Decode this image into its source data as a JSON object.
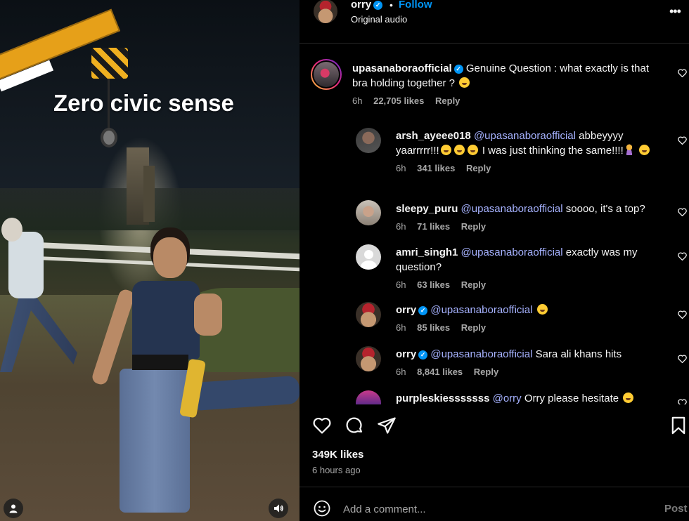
{
  "video": {
    "overlay_text": "Zero civic sense",
    "user_icon": "user-icon",
    "sound_icon": "speaker-icon"
  },
  "header": {
    "username": "orry",
    "verified": true,
    "dot": "•",
    "follow_label": "Follow",
    "subtitle": "Original audio",
    "more_icon": "more-icon"
  },
  "comments": [
    {
      "username": "upasanaboraofficial",
      "verified": true,
      "text": "Genuine Question : what exactly is that bra holding together ?",
      "time": "6h",
      "likes": "22,705 likes",
      "reply": "Reply"
    },
    {
      "username": "arsh_ayeee018",
      "mention": "@upasanaboraofficial",
      "text_a": "abbeyyyy yaarrrrr!!!",
      "text_b": "I was just thinking the same!!!!",
      "time": "6h",
      "likes": "341 likes",
      "reply": "Reply"
    },
    {
      "username": "sleepy_puru",
      "mention": "@upasanaboraofficial",
      "text": "soooo, it's a top?",
      "time": "6h",
      "likes": "71 likes",
      "reply": "Reply"
    },
    {
      "username": "amri_singh1",
      "mention": "@upasanaboraofficial",
      "text": "exactly was my question?",
      "time": "6h",
      "likes": "63 likes",
      "reply": "Reply"
    },
    {
      "username": "orry",
      "verified": true,
      "mention": "@upasanaboraofficial",
      "text": "",
      "time": "6h",
      "likes": "85 likes",
      "reply": "Reply"
    },
    {
      "username": "orry",
      "verified": true,
      "mention": "@upasanaboraofficial",
      "text": "Sara ali khans hits",
      "time": "6h",
      "likes": "8,841 likes",
      "reply": "Reply"
    },
    {
      "username": "purpleskiesssssss",
      "mention": "@orry",
      "text": "Orry please hesitate"
    }
  ],
  "actions": {
    "like_icon": "heart-icon",
    "comment_icon": "comment-icon",
    "share_icon": "share-icon",
    "save_icon": "bookmark-icon"
  },
  "likes": "349K likes",
  "time_ago": "6 hours ago",
  "add_comment": {
    "placeholder": "Add a comment...",
    "post_label": "Post",
    "emoji_icon": "smiley-icon"
  },
  "colors": {
    "background": "#000000",
    "accent": "#0095f6",
    "mention": "#a6b2ff",
    "secondary_text": "#a8a8a8"
  }
}
